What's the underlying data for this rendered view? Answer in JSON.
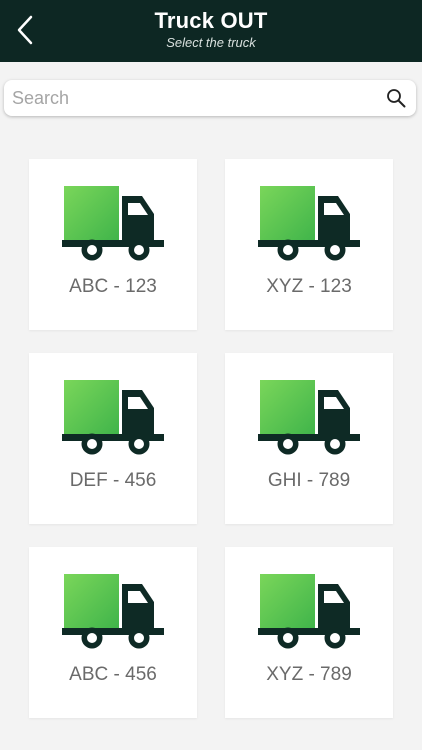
{
  "header": {
    "title": "Truck OUT",
    "subtitle": "Select the truck"
  },
  "search": {
    "placeholder": "Search",
    "value": ""
  },
  "trucks": [
    {
      "label": "ABC - 123"
    },
    {
      "label": "XYZ - 123"
    },
    {
      "label": "DEF - 456"
    },
    {
      "label": "GHI - 789"
    },
    {
      "label": "ABC - 456"
    },
    {
      "label": "XYZ - 789"
    }
  ],
  "icons": {
    "back": "chevron-left-icon",
    "search": "search-icon",
    "truck": "truck-icon"
  },
  "colors": {
    "header_bg": "#0d2723",
    "truck_cargo": "#5ec44a",
    "truck_body": "#0e2a25",
    "page_bg": "#f3f3f3"
  }
}
